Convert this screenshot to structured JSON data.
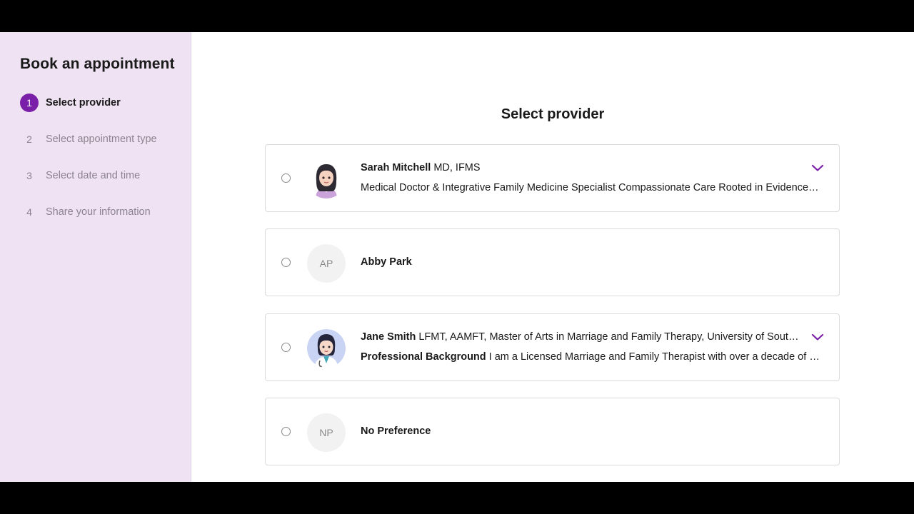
{
  "sidebar": {
    "title": "Book an appointment",
    "steps": [
      {
        "number": "1",
        "label": "Select provider",
        "active": true
      },
      {
        "number": "2",
        "label": "Select appointment type",
        "active": false
      },
      {
        "number": "3",
        "label": "Select date and time",
        "active": false
      },
      {
        "number": "4",
        "label": "Share your information",
        "active": false
      }
    ]
  },
  "main": {
    "title": "Select provider",
    "providers": [
      {
        "name": "Sarah Mitchell",
        "credentials": "MD, IFMS",
        "description": "Medical Doctor & Integrative Family Medicine Specialist Compassionate Care Rooted in Evidence-Based Practice",
        "avatar": "sarah-portrait",
        "expandable": true
      },
      {
        "name": "Abby Park",
        "initials": "AP",
        "expandable": false
      },
      {
        "name": "Jane Smith",
        "credentials": "LFMT, AAMFT, Master of Arts in Marriage and Family Therapy, University of Southern California",
        "description_label": "Professional Background",
        "description": "I am a Licensed Marriage and Family Therapist with over a decade of experience",
        "avatar": "jane-portrait",
        "expandable": true
      },
      {
        "name": "No Preference",
        "initials": "NP",
        "expandable": false
      }
    ]
  },
  "colors": {
    "accent": "#7a1fa8",
    "sidebar_bg": "#efe2f3",
    "muted_text": "#8b8490",
    "card_border": "#dcdcdc"
  }
}
